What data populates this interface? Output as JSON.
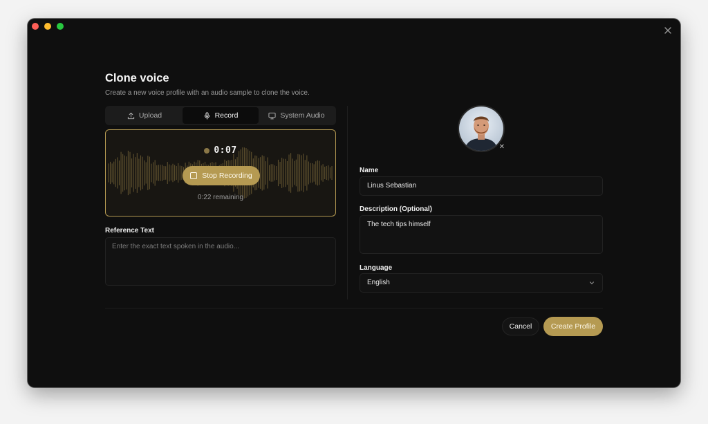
{
  "dialog": {
    "title": "Clone voice",
    "subtitle": "Create a new voice profile with an audio sample to clone the voice."
  },
  "tabs": [
    {
      "label": "Upload",
      "icon": "upload-icon",
      "active": false
    },
    {
      "label": "Record",
      "icon": "microphone-icon",
      "active": true
    },
    {
      "label": "System Audio",
      "icon": "monitor-icon",
      "active": false
    }
  ],
  "recording": {
    "timer": "0:07",
    "stop_label": "Stop Recording",
    "remaining": "0:22 remaining",
    "accent": "#b59a52"
  },
  "reference": {
    "label": "Reference Text",
    "placeholder": "Enter the exact text spoken in the audio..."
  },
  "form": {
    "name_label": "Name",
    "name_value": "Linus Sebastian",
    "description_label": "Description (Optional)",
    "description_value": "The tech tips himself",
    "language_label": "Language",
    "language_value": "English"
  },
  "actions": {
    "cancel": "Cancel",
    "create": "Create Profile"
  }
}
